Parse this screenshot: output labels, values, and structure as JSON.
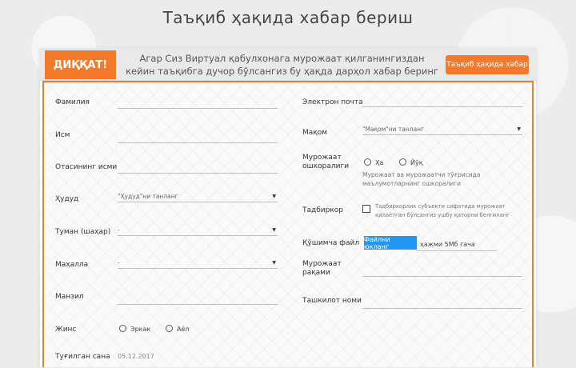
{
  "page": {
    "title": "Таъқиб ҳақида хабар бериш"
  },
  "banner": {
    "warning": "ДИҚҚАТ!",
    "text": "Агар Сиз Виртуал қабулхонага мурожаат қилганингиздан кейин таъқибга дучор бўлсангиз бу ҳақда дарҳол хабар беринг",
    "button": "Таъқиб ҳақида хабар"
  },
  "form": {
    "left": {
      "surname_label": "Фамилия",
      "name_label": "Исм",
      "patronymic_label": "Отасининг исми",
      "region_label": "Ҳудуд",
      "region_placeholder": "\"Ҳудуд\"ни танланг",
      "district_label": "Туман (шаҳар)",
      "district_value": "-",
      "mahalla_label": "Маҳалла",
      "mahalla_value": "-",
      "address_label": "Манзил",
      "gender_label": "Жинс",
      "gender_options": [
        "Эркак",
        "Аёл"
      ],
      "birthdate_label": "Туғилган сана",
      "birthdate_value": "05.12.2017"
    },
    "right": {
      "email_label": "Электрон почта",
      "status_label": "Мақом",
      "status_placeholder": "\"Мақом\"ни танланг",
      "openness_label": "Мурожаат ошкоралиги",
      "openness_options": [
        "Ҳа",
        "Йўқ"
      ],
      "openness_note": "Мурожаат ва мурожаатчи тўғрисида маълумотларнинг ошкоралиги",
      "entrepreneur_label": "Тадбиркор",
      "entrepreneur_note": "Тадбиркорлик субъекти сифатида мурожаат қилаётган бўлсангиз ушбу қаторни белгиланг",
      "extra_file_label": "Қўшимча файл",
      "file_button": "Файлни юкланг",
      "file_hint": "ҳажми 5Мб гача",
      "appeal_number_label": "Мурожаат рақами",
      "organization_label": "Ташкилот номи"
    }
  },
  "colors": {
    "accent": "#f47a2b",
    "file_button": "#2196f3"
  }
}
